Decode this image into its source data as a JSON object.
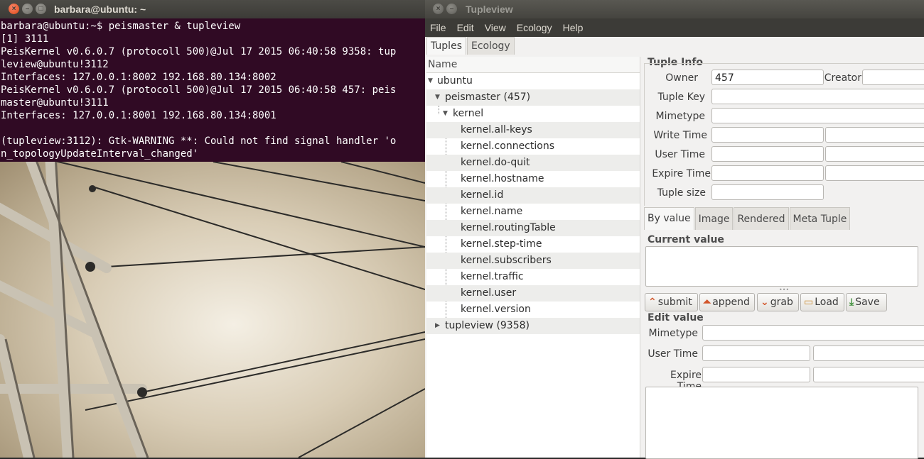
{
  "terminal": {
    "title": "barbara@ubuntu: ~",
    "lines": [
      "barbara@ubuntu:~$ peismaster & tupleview",
      "[1] 3111",
      "PeisKernel v0.6.0.7 (protocoll 500)@Jul 17 2015 06:40:58 9358: tup",
      "leview@ubuntu!3112",
      "Interfaces: 127.0.0.1:8002 192.168.80.134:8002",
      "PeisKernel v0.6.0.7 (protocoll 500)@Jul 17 2015 06:40:58 457: peis",
      "master@ubuntu!3111",
      "Interfaces: 127.0.0.1:8001 192.168.80.134:8001",
      "",
      "(tupleview:3112): Gtk-WARNING **: Could not find signal handler 'o",
      "n_topologyUpdateInterval_changed'"
    ]
  },
  "tupleview": {
    "title": "Tupleview",
    "menu": [
      "File",
      "Edit",
      "View",
      "Ecology",
      "Help"
    ],
    "main_tabs": [
      "Tuples",
      "Ecology"
    ],
    "tree_header": "Name",
    "tree": {
      "root": "ubuntu",
      "node1": "peismaster (457)",
      "node1_child": "kernel",
      "leaves": [
        "kernel.all-keys",
        "kernel.connections",
        "kernel.do-quit",
        "kernel.hostname",
        "kernel.id",
        "kernel.name",
        "kernel.routingTable",
        "kernel.step-time",
        "kernel.subscribers",
        "kernel.traffic",
        "kernel.user",
        "kernel.version"
      ],
      "node2": "tupleview (9358)"
    },
    "tuple_info": {
      "section": "Tuple Info",
      "owner_label": "Owner",
      "owner_value": "457",
      "creator_label": "Creator",
      "tuple_key_label": "Tuple Key",
      "mimetype_label": "Mimetype",
      "write_time_label": "Write Time",
      "user_time_label": "User Time",
      "expire_time_label": "Expire Time",
      "tuple_size_label": "Tuple size"
    },
    "value_tabs": [
      "By value",
      "Image",
      "Rendered",
      "Meta Tuple"
    ],
    "current_value_label": "Current value",
    "buttons": {
      "submit": "submit",
      "append": "append",
      "grab": "grab",
      "load": "Load",
      "save": "Save"
    },
    "edit_value": {
      "section": "Edit value",
      "mimetype_label": "Mimetype",
      "user_time_label": "User Time",
      "expire_time_label": "Expire Time"
    }
  }
}
